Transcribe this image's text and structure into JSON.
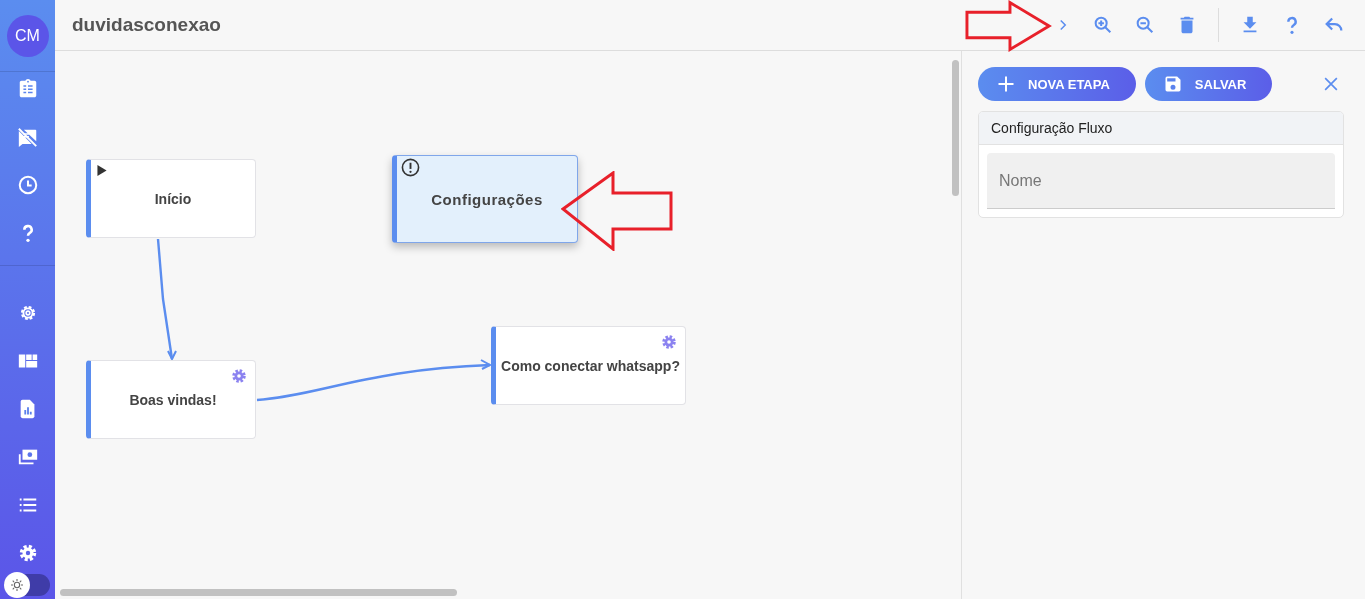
{
  "sidebar": {
    "avatar": "CM",
    "dark_mode": false
  },
  "header": {
    "title": "duvidasconexao"
  },
  "nodes": [
    {
      "label": "Início",
      "kind": "start",
      "selected": false
    },
    {
      "label": "Configurações",
      "kind": "warning",
      "selected": true
    },
    {
      "label": "Boas vindas!",
      "kind": "settings",
      "selected": false
    },
    {
      "label": "Como conectar whatsapp?",
      "kind": "settings",
      "selected": false
    }
  ],
  "panel": {
    "buttons": [
      {
        "label": "NOVA ETAPA",
        "kind": "add"
      },
      {
        "label": "SALVAR",
        "kind": "save"
      }
    ],
    "card_title": "Configuração Fluxo",
    "field": {
      "placeholder": "Nome"
    }
  }
}
